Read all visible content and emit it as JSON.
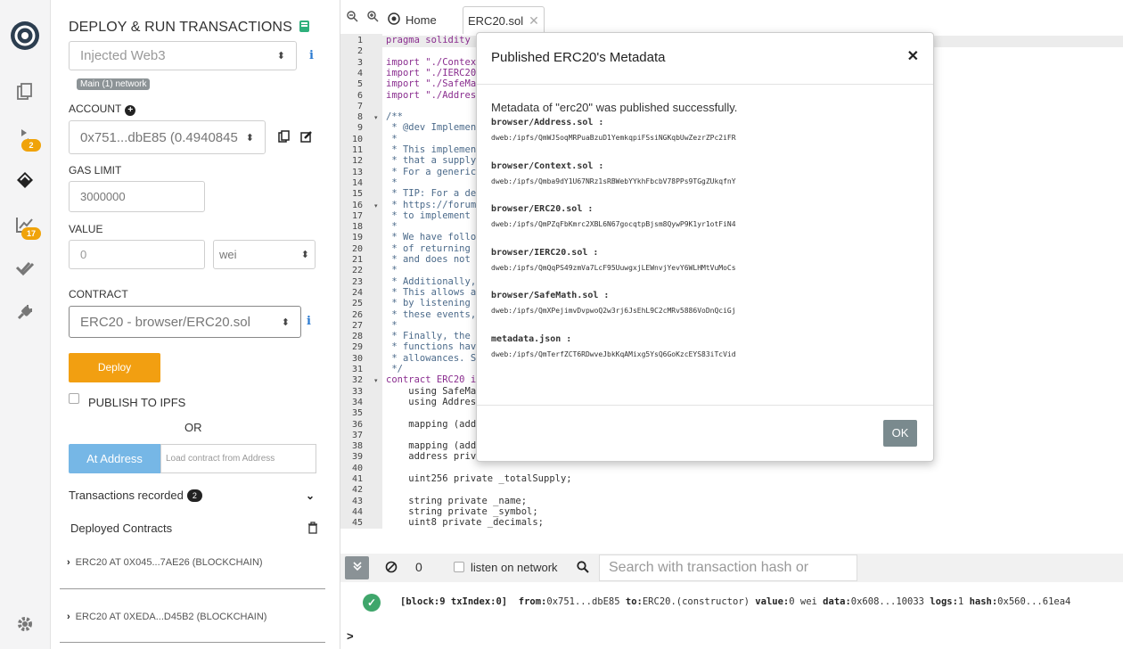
{
  "panel": {
    "title": "DEPLOY & RUN TRANSACTIONS",
    "environment": "Injected Web3",
    "network_badge": "Main (1) network",
    "account_label": "ACCOUNT",
    "account_value": "0x751...dbE85 (0.4940845",
    "gas_limit_label": "GAS LIMIT",
    "gas_limit_value": "3000000",
    "value_label": "VALUE",
    "value_amount": "0",
    "value_unit": "wei",
    "contract_label": "CONTRACT",
    "contract_value": "ERC20 - browser/ERC20.sol",
    "deploy_label": "Deploy",
    "publish_label": "PUBLISH TO IPFS",
    "or_label": "OR",
    "at_address_label": "At Address",
    "at_address_placeholder": "Load contract from Address",
    "tx_recorded_label": "Transactions recorded",
    "tx_recorded_count": "2",
    "deployed_label": "Deployed Contracts",
    "deployed": [
      "ERC20 AT 0X045...7AE26 (BLOCKCHAIN)",
      "ERC20 AT 0XEDA...D45B2 (BLOCKCHAIN)"
    ]
  },
  "rail": {
    "badge_solidity": "2",
    "badge_analysis": "17"
  },
  "tabs": {
    "home": "Home",
    "file": "ERC20.sol"
  },
  "editor": {
    "line_numbers": [
      "1",
      "2",
      "3",
      "4",
      "5",
      "6",
      "7",
      "8",
      "9",
      "10",
      "11",
      "12",
      "13",
      "14",
      "15",
      "16",
      "17",
      "18",
      "19",
      "20",
      "21",
      "22",
      "23",
      "24",
      "25",
      "26",
      "27",
      "28",
      "29",
      "30",
      "31",
      "32",
      "33",
      "34",
      "35",
      "36",
      "37",
      "38",
      "39",
      "40",
      "41",
      "42",
      "43",
      "44",
      "45"
    ],
    "lines": [
      "pragma solidity ^",
      "",
      "import \"./Contex",
      "import \"./IERC20",
      "import \"./SafeMa",
      "import \"./Addres",
      "",
      "/**",
      " * @dev Implemen",
      " *",
      " * This implemen",
      " * that a supply",
      " * For a generic",
      " *",
      " * TIP: For a de",
      " * https://forum",
      " * to implement",
      " *",
      " * We have follo",
      " * of returning",
      " * and does not",
      " *",
      " * Additionally,",
      " * This allows a",
      " * by listening",
      " * these events,",
      " *",
      " * Finally, the",
      " * functions hav",
      " * allowances. S",
      " */",
      "contract ERC20 i",
      "    using SafeMa",
      "    using Address",
      "",
      "    mapping (add",
      "",
      "    mapping (add",
      "    address private _owner = _msgSender();",
      "",
      "    uint256 private _totalSupply;",
      "",
      "    string private _name;",
      "    string private _symbol;",
      "    uint8 private _decimals;"
    ]
  },
  "terminal": {
    "count": "0",
    "listen_label": "listen on network",
    "search_placeholder": "Search with transaction hash or address",
    "tx": {
      "block": "[block:9 txIndex:0]",
      "from_label": "from:",
      "from": "0x751...dbE85",
      "to_label": "to:",
      "to": "ERC20.(constructor)",
      "value_label": "value:",
      "value": "0 wei",
      "data_label": "data:",
      "data": "0x608...10033",
      "logs_label": "logs:",
      "logs": "1",
      "hash_label": "hash:",
      "hash": "0x560...61ea4"
    },
    "prompt": ">"
  },
  "modal": {
    "title": "Published ERC20's Metadata",
    "message": "Metadata of \"erc20\" was published successfully.",
    "items": [
      {
        "name": "browser/Address.sol :",
        "hash": "dweb:/ipfs/QmWJSoqMRPuaBzuD1YemkqpiFSsiNGKqbUwZezrZPc2iFR"
      },
      {
        "name": "browser/Context.sol :",
        "hash": "dweb:/ipfs/Qmba9dY1U67NRz1sRBWebYYkhFbcbV78PPs9TGgZUkqfnY"
      },
      {
        "name": "browser/ERC20.sol :",
        "hash": "dweb:/ipfs/QmPZqFbKmrc2XBL6N67gocqtpBjsm8QywP9K1yr1otFiN4"
      },
      {
        "name": "browser/IERC20.sol :",
        "hash": "dweb:/ipfs/QmQqPS49zmVa7LcF95UuwgxjLEWnvjYevY6WLHMtVuMoCs"
      },
      {
        "name": "browser/SafeMath.sol :",
        "hash": "dweb:/ipfs/QmXPejimvDvpwoQ2w3rj6JsEhL9C2cMRv5886VoDnQciGj"
      },
      {
        "name": "metadata.json :",
        "hash": "dweb:/ipfs/QmTerfZCT6RDwveJbkKqAMixg5YsQ6GoKzcEYS83iTcVid"
      }
    ],
    "ok_label": "OK"
  },
  "colors": {
    "deploy": "#f29f11",
    "at_address": "#76b7e6",
    "badge": "#f0a30a",
    "success": "#3fa66b"
  }
}
